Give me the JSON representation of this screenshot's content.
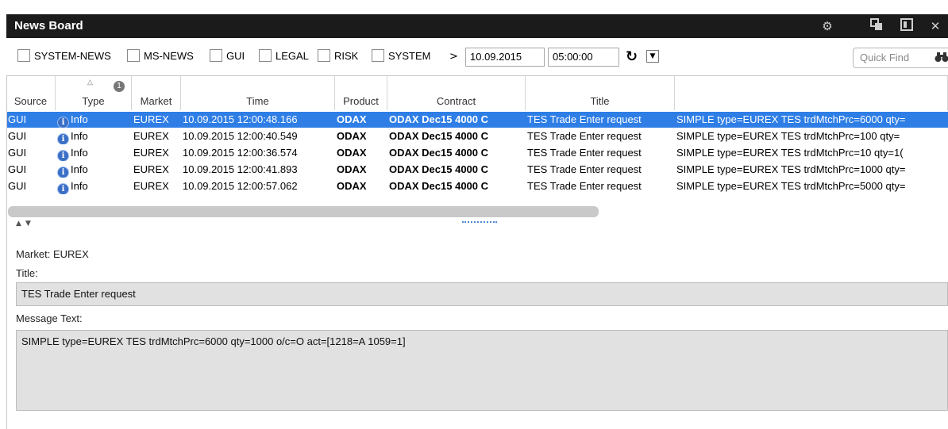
{
  "window": {
    "title": "News Board"
  },
  "toolbar": {
    "filters": [
      {
        "label": "SYSTEM-NEWS",
        "checked": false
      },
      {
        "label": "MS-NEWS",
        "checked": false
      },
      {
        "label": "GUI",
        "checked": false
      },
      {
        "label": "LEGAL",
        "checked": false
      },
      {
        "label": "RISK",
        "checked": false
      },
      {
        "label": "SYSTEM",
        "checked": false
      }
    ],
    "gt_symbol": ">",
    "date": "10.09.2015",
    "time": "05:00:00",
    "quick_find_placeholder": "Quick Find"
  },
  "grid": {
    "columns": [
      "Source",
      "Type",
      "Market",
      "Time",
      "Product",
      "Contract",
      "Title"
    ],
    "sort_badge": "1",
    "rows": [
      {
        "source": "GUI",
        "type": "Info",
        "market": "EUREX",
        "time": "10.09.2015 12:00:48.166",
        "product": "ODAX",
        "contract": "ODAX Dec15 4000 C",
        "title": "TES Trade Enter request",
        "message": "SIMPLE type=EUREX TES trdMtchPrc=6000 qty=",
        "selected": true
      },
      {
        "source": "GUI",
        "type": "Info",
        "market": "EUREX",
        "time": "10.09.2015 12:00:40.549",
        "product": "ODAX",
        "contract": "ODAX Dec15 4000 C",
        "title": "TES Trade Enter request",
        "message": "SIMPLE type=EUREX TES trdMtchPrc=100 qty=",
        "selected": false
      },
      {
        "source": "GUI",
        "type": "Info",
        "market": "EUREX",
        "time": "10.09.2015 12:00:36.574",
        "product": "ODAX",
        "contract": "ODAX Dec15 4000 C",
        "title": "TES Trade Enter request",
        "message": "SIMPLE type=EUREX TES trdMtchPrc=10 qty=1(",
        "selected": false
      },
      {
        "source": "GUI",
        "type": "Info",
        "market": "EUREX",
        "time": "10.09.2015 12:00:41.893",
        "product": "ODAX",
        "contract": "ODAX Dec15 4000 C",
        "title": "TES Trade Enter request",
        "message": "SIMPLE type=EUREX TES trdMtchPrc=1000 qty=",
        "selected": false
      },
      {
        "source": "GUI",
        "type": "Info",
        "market": "EUREX",
        "time": "10.09.2015 12:00:57.062",
        "product": "ODAX",
        "contract": "ODAX Dec15 4000 C",
        "title": "TES Trade Enter request",
        "message": "SIMPLE type=EUREX TES trdMtchPrc=5000 qty=",
        "selected": false
      }
    ]
  },
  "detail": {
    "market_line": "Market: EUREX",
    "title_label": "Title:",
    "title_value": "TES Trade Enter request",
    "message_label": "Message Text:",
    "message_value": "SIMPLE type=EUREX TES trdMtchPrc=6000 qty=1000 o/c=O act=[1218=A 1059=1]"
  },
  "icons": {
    "settings": "gear-icon",
    "restore": "window-restore-icon",
    "export": "export-icon",
    "close": "close-icon",
    "refresh": "refresh-icon",
    "dropdown": "chevron-down-icon",
    "search": "binoculars-icon",
    "info": "info-icon"
  },
  "colors": {
    "titlebar": "#1b1b1b",
    "selection": "#2e7ee6",
    "detail_box": "#e1e1e1"
  }
}
